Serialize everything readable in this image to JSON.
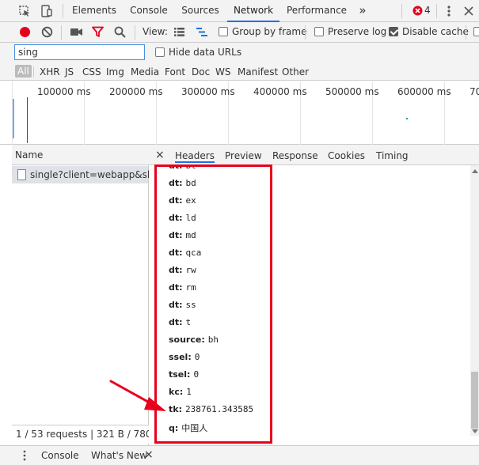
{
  "main_tabs": [
    {
      "label": "Elements"
    },
    {
      "label": "Console"
    },
    {
      "label": "Sources"
    },
    {
      "label": "Network"
    },
    {
      "label": "Performance"
    }
  ],
  "more_tabs": "»",
  "error_count": "4",
  "toolbar": {
    "view_label": "View:",
    "group_by_frame": "Group by frame",
    "preserve_log": "Preserve log",
    "disable_cache": "Disable cache"
  },
  "filter": {
    "value": "sing",
    "hide_data_urls": "Hide data URLs"
  },
  "types": [
    "All",
    "XHR",
    "JS",
    "CSS",
    "Img",
    "Media",
    "Font",
    "Doc",
    "WS",
    "Manifest",
    "Other"
  ],
  "overview_ticks": [
    "100000 ms",
    "200000 ms",
    "300000 ms",
    "400000 ms",
    "500000 ms",
    "600000 ms",
    "70"
  ],
  "requests": {
    "header": "Name",
    "rows": [
      {
        "name": "single?client=webapp&sl..."
      }
    ],
    "status": "1 / 53 requests  |  321 B / 780 ..."
  },
  "detail_tabs": {
    "close": "×",
    "items": [
      "Headers",
      "Preview",
      "Response",
      "Cookies",
      "Timing"
    ]
  },
  "params": [
    {
      "key": "dt:",
      "value": "bt"
    },
    {
      "key": "dt:",
      "value": "bd"
    },
    {
      "key": "dt:",
      "value": "ex"
    },
    {
      "key": "dt:",
      "value": "ld"
    },
    {
      "key": "dt:",
      "value": "md"
    },
    {
      "key": "dt:",
      "value": "qca"
    },
    {
      "key": "dt:",
      "value": "rw"
    },
    {
      "key": "dt:",
      "value": "rm"
    },
    {
      "key": "dt:",
      "value": "ss"
    },
    {
      "key": "dt:",
      "value": "t"
    },
    {
      "key": "source:",
      "value": "bh"
    },
    {
      "key": "ssel:",
      "value": "0"
    },
    {
      "key": "tsel:",
      "value": "0"
    },
    {
      "key": "kc:",
      "value": "1"
    },
    {
      "key": "tk:",
      "value": "238761.343585"
    },
    {
      "key": "q:",
      "value": "中国人"
    }
  ],
  "drawer": {
    "items": [
      "Console",
      "What's New"
    ],
    "close": "×"
  },
  "colors": {
    "accent": "#1a73e8",
    "record": "#e8001c",
    "highlight": "#e8001c"
  }
}
